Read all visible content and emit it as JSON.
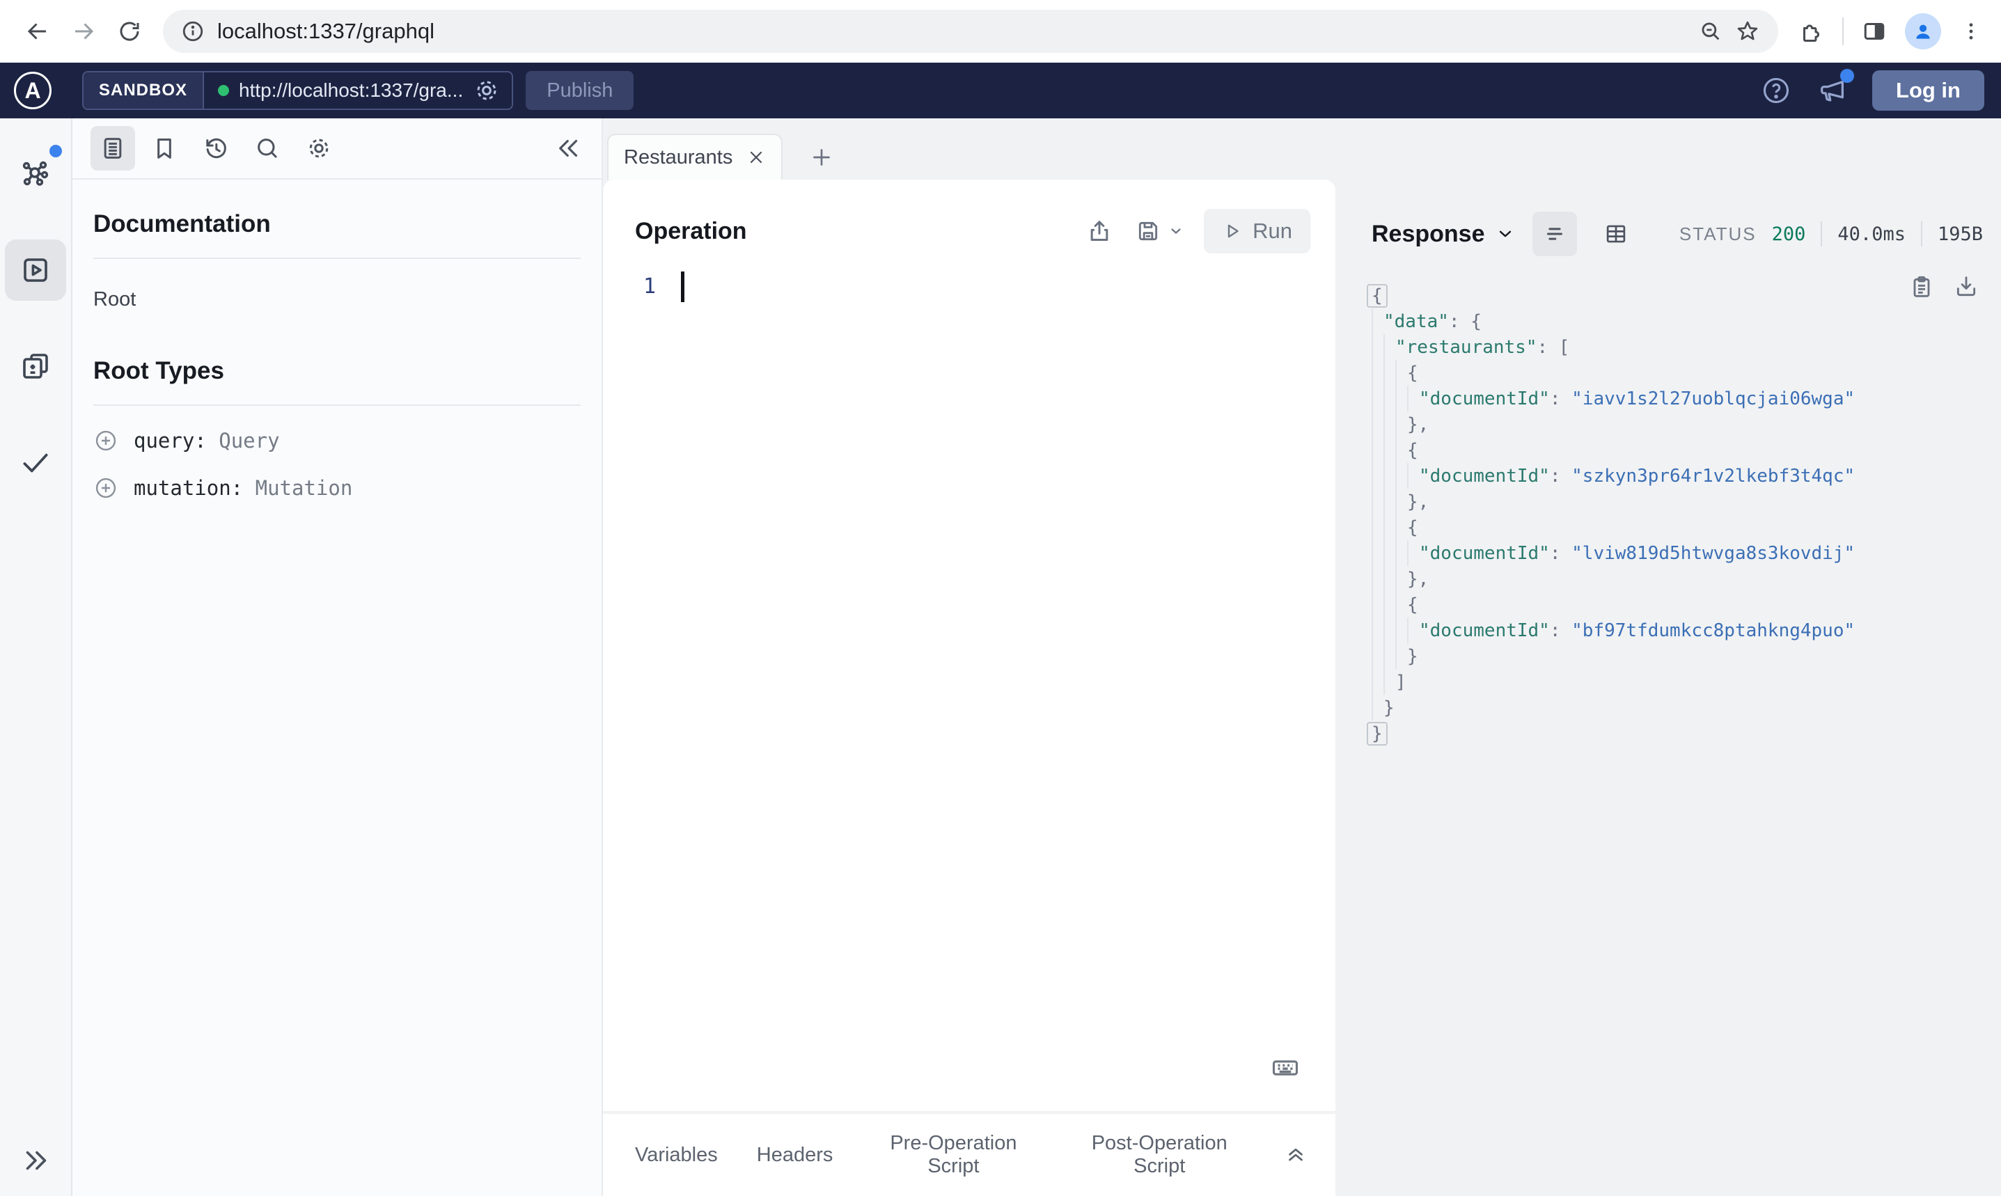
{
  "browser": {
    "url": "localhost:1337/graphql"
  },
  "header": {
    "env_label": "SANDBOX",
    "endpoint": "http://localhost:1337/gra...",
    "publish_label": "Publish",
    "login_label": "Log in"
  },
  "docs": {
    "title": "Documentation",
    "root_link": "Root",
    "section_title": "Root Types",
    "root_types": [
      {
        "field": "query:",
        "type": "Query"
      },
      {
        "field": "mutation:",
        "type": "Mutation"
      }
    ]
  },
  "tabs": {
    "active_label": "Restaurants"
  },
  "operation": {
    "title": "Operation",
    "run_label": "Run",
    "line_number": "1"
  },
  "response": {
    "title": "Response",
    "status_label": "STATUS",
    "status_code": "200",
    "duration": "40.0ms",
    "size": "195B",
    "json_lines": [
      {
        "indent": 0,
        "boxed": true,
        "segments": [
          {
            "text": "{",
            "type": "punc"
          }
        ]
      },
      {
        "indent": 1,
        "segments": [
          {
            "text": "\"data\"",
            "type": "key"
          },
          {
            "text": ": {",
            "type": "punc"
          }
        ]
      },
      {
        "indent": 2,
        "segments": [
          {
            "text": "\"restaurants\"",
            "type": "key"
          },
          {
            "text": ": [",
            "type": "punc"
          }
        ]
      },
      {
        "indent": 3,
        "segments": [
          {
            "text": "{",
            "type": "punc"
          }
        ]
      },
      {
        "indent": 4,
        "segments": [
          {
            "text": "\"documentId\"",
            "type": "key"
          },
          {
            "text": ": ",
            "type": "punc"
          },
          {
            "text": "\"iavv1s2l27uoblqcjai06wga\"",
            "type": "string"
          }
        ]
      },
      {
        "indent": 3,
        "segments": [
          {
            "text": "},",
            "type": "punc"
          }
        ]
      },
      {
        "indent": 3,
        "segments": [
          {
            "text": "{",
            "type": "punc"
          }
        ]
      },
      {
        "indent": 4,
        "segments": [
          {
            "text": "\"documentId\"",
            "type": "key"
          },
          {
            "text": ": ",
            "type": "punc"
          },
          {
            "text": "\"szkyn3pr64r1v2lkebf3t4qc\"",
            "type": "string"
          }
        ]
      },
      {
        "indent": 3,
        "segments": [
          {
            "text": "},",
            "type": "punc"
          }
        ]
      },
      {
        "indent": 3,
        "segments": [
          {
            "text": "{",
            "type": "punc"
          }
        ]
      },
      {
        "indent": 4,
        "segments": [
          {
            "text": "\"documentId\"",
            "type": "key"
          },
          {
            "text": ": ",
            "type": "punc"
          },
          {
            "text": "\"lviw819d5htwvga8s3kovdij\"",
            "type": "string"
          }
        ]
      },
      {
        "indent": 3,
        "segments": [
          {
            "text": "},",
            "type": "punc"
          }
        ]
      },
      {
        "indent": 3,
        "segments": [
          {
            "text": "{",
            "type": "punc"
          }
        ]
      },
      {
        "indent": 4,
        "segments": [
          {
            "text": "\"documentId\"",
            "type": "key"
          },
          {
            "text": ": ",
            "type": "punc"
          },
          {
            "text": "\"bf97tfdumkcc8ptahkng4puo\"",
            "type": "string"
          }
        ]
      },
      {
        "indent": 3,
        "segments": [
          {
            "text": "}",
            "type": "punc"
          }
        ]
      },
      {
        "indent": 2,
        "segments": [
          {
            "text": "]",
            "type": "punc"
          }
        ]
      },
      {
        "indent": 1,
        "segments": [
          {
            "text": "}",
            "type": "punc"
          }
        ]
      },
      {
        "indent": 0,
        "boxed": true,
        "segments": [
          {
            "text": "}",
            "type": "punc"
          }
        ]
      }
    ]
  },
  "footer": {
    "tabs": [
      "Variables",
      "Headers",
      "Pre-Operation Script",
      "Post-Operation Script"
    ]
  },
  "colors": {
    "header_bg": "#1c2342",
    "status_ok_green": "#0d7a5c",
    "endpoint_dot_green": "#2fbf71",
    "notification_blue": "#3d83ee",
    "json_key_teal": "#2b7a6e",
    "json_string_blue": "#3b6fb5"
  },
  "icons": [
    "back-arrow",
    "forward-arrow",
    "reload",
    "site-info",
    "zoom-out",
    "bookmark-star",
    "extensions-puzzle",
    "side-panel",
    "profile-avatar",
    "kebab-menu",
    "apollo-logo",
    "gear",
    "help-circle",
    "megaphone",
    "graph-network",
    "explorer-play",
    "changelog-docs",
    "checklist-check",
    "expand-chevrons",
    "docs-text",
    "bookmark",
    "history-clock",
    "search",
    "collapse-chevrons",
    "share",
    "save-floppy",
    "chevron-down",
    "play-triangle",
    "list-view",
    "table-view",
    "copy-clipboard",
    "download",
    "keyboard",
    "circle-plus",
    "collapse-up-chevrons",
    "close-x",
    "add-plus"
  ]
}
